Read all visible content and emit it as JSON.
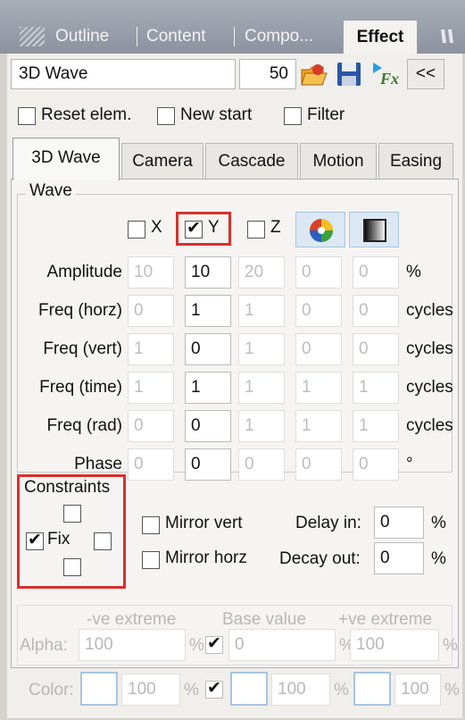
{
  "top_tabs": [
    "Outline",
    "Content",
    "Compo..."
  ],
  "active_top_tab": "Effect",
  "header": {
    "effect_name": "3D Wave",
    "value": "50",
    "collapse_label": "<<"
  },
  "options": {
    "reset_elem": "Reset elem.",
    "new_start": "New start",
    "filter": "Filter"
  },
  "inner_tabs": [
    "3D Wave",
    "Camera",
    "Cascade",
    "Motion",
    "Easing"
  ],
  "wave": {
    "group_label": "Wave",
    "axis_x": "X",
    "axis_y": "Y",
    "axis_z": "Z",
    "rows": [
      {
        "label": "Amplitude",
        "values": [
          "10",
          "10",
          "20",
          "0",
          "0"
        ],
        "unit": "%"
      },
      {
        "label": "Freq (horz)",
        "values": [
          "0",
          "1",
          "1",
          "0",
          "0"
        ],
        "unit": "cycles"
      },
      {
        "label": "Freq (vert)",
        "values": [
          "1",
          "0",
          "1",
          "0",
          "0"
        ],
        "unit": "cycles"
      },
      {
        "label": "Freq (time)",
        "values": [
          "1",
          "1",
          "1",
          "1",
          "1"
        ],
        "unit": "cycles"
      },
      {
        "label": "Freq (rad)",
        "values": [
          "0",
          "0",
          "1",
          "1",
          "1"
        ],
        "unit": "cycles"
      },
      {
        "label": "Phase",
        "values": [
          "0",
          "0",
          "0",
          "0",
          "0"
        ],
        "unit": "°"
      }
    ]
  },
  "constraints": {
    "label": "Constraints",
    "fix_label": "Fix",
    "mirror_vert": "Mirror vert",
    "mirror_horz": "Mirror horz",
    "delay_in_label": "Delay in:",
    "delay_in_value": "0",
    "decay_out_label": "Decay out:",
    "decay_out_value": "0",
    "percent": "%"
  },
  "extremes": {
    "neg_label": "-ve extreme",
    "base_label": "Base value",
    "pos_label": "+ve extreme",
    "alpha_label": "Alpha:",
    "alpha_neg": "100",
    "alpha_base": "0",
    "alpha_pos": "100",
    "color_label": "Color:",
    "color_neg": "100",
    "color_base": "100",
    "color_pos": "100",
    "percent": "%"
  }
}
